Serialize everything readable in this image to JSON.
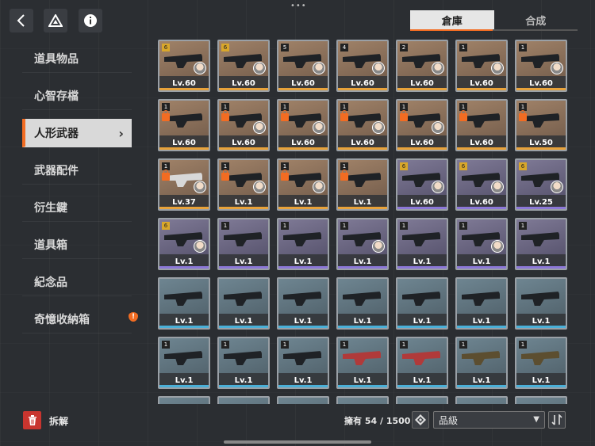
{
  "top": {
    "back_icon": "back-chevron-icon",
    "drive_icon": "drive-triangle-icon",
    "info_icon": "info-icon",
    "more_dots": "•••"
  },
  "tabs": [
    {
      "label": "倉庫",
      "active": true
    },
    {
      "label": "合成",
      "active": false
    }
  ],
  "sidebar": {
    "items": [
      {
        "label": "道具物品"
      },
      {
        "label": "心智存檔"
      },
      {
        "label": "人形武器",
        "active": true
      },
      {
        "label": "武器配件"
      },
      {
        "label": "衍生鍵"
      },
      {
        "label": "道具箱"
      },
      {
        "label": "紀念品"
      },
      {
        "label": "奇憶收納箱",
        "badge": "!"
      }
    ]
  },
  "colors": {
    "accent": "#f26c22",
    "rarity_orange": "#e8a23a",
    "rarity_purple": "#8c78d8",
    "rarity_blue": "#4ab0d8"
  },
  "inventory": {
    "items": [
      {
        "level": "Lv.60",
        "count": "6",
        "rarity": "orange",
        "avatar": true,
        "gold": true
      },
      {
        "level": "Lv.60",
        "count": "6",
        "rarity": "orange",
        "avatar": true,
        "gold": true
      },
      {
        "level": "Lv.60",
        "count": "5",
        "rarity": "orange",
        "avatar": true
      },
      {
        "level": "Lv.60",
        "count": "4",
        "rarity": "orange",
        "avatar": true
      },
      {
        "level": "Lv.60",
        "count": "2",
        "rarity": "orange",
        "avatar": true
      },
      {
        "level": "Lv.60",
        "count": "1",
        "rarity": "orange",
        "avatar": true
      },
      {
        "level": "Lv.60",
        "count": "1",
        "rarity": "orange",
        "avatar": true
      },
      {
        "level": "Lv.60",
        "count": "1",
        "rarity": "orange",
        "lock": true
      },
      {
        "level": "Lv.60",
        "count": "1",
        "rarity": "orange",
        "lock": true,
        "avatar": true
      },
      {
        "level": "Lv.60",
        "count": "1",
        "rarity": "orange",
        "lock": true,
        "avatar": true
      },
      {
        "level": "Lv.60",
        "count": "1",
        "rarity": "orange",
        "lock": true,
        "avatar": true
      },
      {
        "level": "Lv.60",
        "count": "1",
        "rarity": "orange",
        "lock": true,
        "avatar": true
      },
      {
        "level": "Lv.60",
        "count": "1",
        "rarity": "orange",
        "lock": true
      },
      {
        "level": "Lv.50",
        "count": "1",
        "rarity": "orange",
        "lock": true
      },
      {
        "level": "Lv.37",
        "count": "1",
        "rarity": "orange",
        "lock": true,
        "avatar": true,
        "gun": "white"
      },
      {
        "level": "Lv.1",
        "count": "1",
        "rarity": "orange",
        "lock": true,
        "avatar": true
      },
      {
        "level": "Lv.1",
        "count": "1",
        "rarity": "orange",
        "lock": true,
        "avatar": true
      },
      {
        "level": "Lv.1",
        "count": "1",
        "rarity": "orange",
        "lock": true
      },
      {
        "level": "Lv.60",
        "count": "6",
        "rarity": "purple",
        "avatar": true,
        "gold": true
      },
      {
        "level": "Lv.60",
        "count": "6",
        "rarity": "purple",
        "avatar": true,
        "gold": true
      },
      {
        "level": "Lv.25",
        "count": "6",
        "rarity": "purple",
        "avatar": true,
        "gold": true
      },
      {
        "level": "Lv.1",
        "count": "6",
        "rarity": "purple",
        "avatar": true,
        "gold": true
      },
      {
        "level": "Lv.1",
        "count": "1",
        "rarity": "purple"
      },
      {
        "level": "Lv.1",
        "count": "1",
        "rarity": "purple"
      },
      {
        "level": "Lv.1",
        "count": "1",
        "rarity": "purple",
        "avatar": true
      },
      {
        "level": "Lv.1",
        "count": "1",
        "rarity": "purple"
      },
      {
        "level": "Lv.1",
        "count": "1",
        "rarity": "purple",
        "avatar": true
      },
      {
        "level": "Lv.1",
        "count": "1",
        "rarity": "purple"
      },
      {
        "level": "Lv.1",
        "count": "",
        "rarity": "blue"
      },
      {
        "level": "Lv.1",
        "count": "",
        "rarity": "blue"
      },
      {
        "level": "Lv.1",
        "count": "",
        "rarity": "blue"
      },
      {
        "level": "Lv.1",
        "count": "",
        "rarity": "blue"
      },
      {
        "level": "Lv.1",
        "count": "",
        "rarity": "blue"
      },
      {
        "level": "Lv.1",
        "count": "",
        "rarity": "blue"
      },
      {
        "level": "Lv.1",
        "count": "",
        "rarity": "blue"
      },
      {
        "level": "Lv.1",
        "count": "1",
        "rarity": "blue"
      },
      {
        "level": "Lv.1",
        "count": "1",
        "rarity": "blue"
      },
      {
        "level": "Lv.1",
        "count": "1",
        "rarity": "blue"
      },
      {
        "level": "Lv.1",
        "count": "1",
        "rarity": "blue",
        "gun": "red"
      },
      {
        "level": "Lv.1",
        "count": "1",
        "rarity": "blue",
        "gun": "red"
      },
      {
        "level": "Lv.1",
        "count": "1",
        "rarity": "blue",
        "gun": "camo"
      },
      {
        "level": "Lv.1",
        "count": "1",
        "rarity": "blue",
        "gun": "camo"
      },
      {
        "level": "",
        "count": "",
        "rarity": "blue"
      },
      {
        "level": "",
        "count": "",
        "rarity": "blue"
      },
      {
        "level": "",
        "count": "",
        "rarity": "blue"
      },
      {
        "level": "",
        "count": "",
        "rarity": "blue"
      },
      {
        "level": "",
        "count": "",
        "rarity": "blue"
      },
      {
        "level": "",
        "count": "",
        "rarity": "blue"
      },
      {
        "level": "",
        "count": "",
        "rarity": "blue"
      }
    ]
  },
  "footer": {
    "dismantle_label": "拆解",
    "owned_text": "擁有 54 / 1500",
    "sort_value": "品級"
  }
}
